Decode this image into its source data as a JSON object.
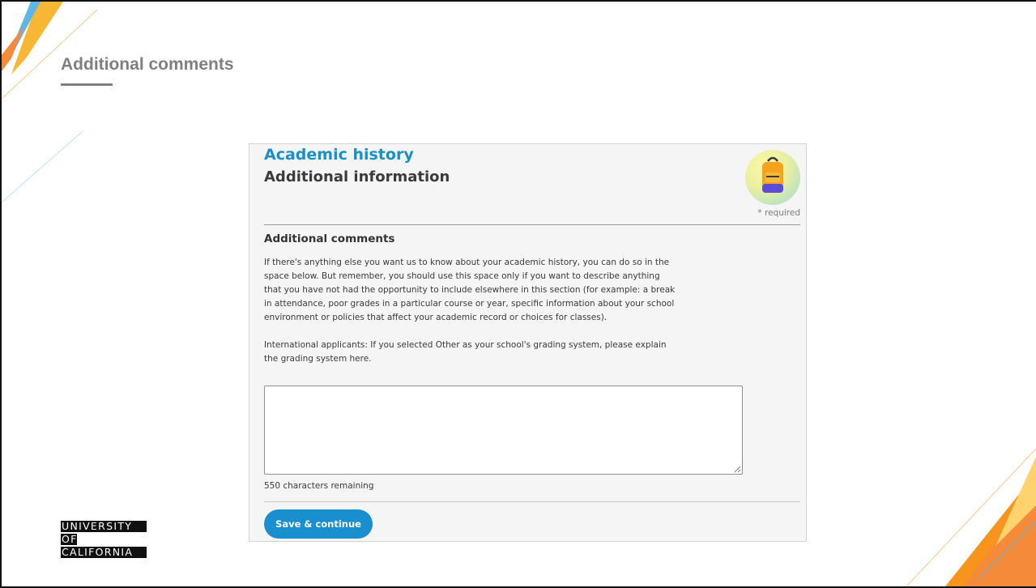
{
  "slide": {
    "title": "Additional comments"
  },
  "logo": {
    "line1": "UNIVERSITY",
    "line2": "OF",
    "line3": "CALIFORNIA"
  },
  "form": {
    "section_kicker": "Academic history",
    "section_title": "Additional information",
    "required_note": "* required",
    "field_heading": "Additional comments",
    "instructions_1": "If there's anything else you want us to know about your academic history, you can do so in the space below. But remember, you should use this space only if you want to describe anything that you have not had the opportunity to include elsewhere in this section (for example: a break in attendance, poor grades in a particular course or year, specific information about your school environment or policies that affect your academic record or choices for classes).",
    "instructions_2": "International applicants: If you selected Other as your school's grading system, please explain the grading system here.",
    "comment_value": "",
    "chars_remaining": "550 characters remaining",
    "save_label": "Save & continue"
  },
  "colors": {
    "accent_blue": "#1a90c9",
    "button_blue": "#1a8fd0",
    "title_gray": "#7f7f7f"
  },
  "icons": {
    "badge": "backpack-icon",
    "grip": "resize-handle-icon"
  }
}
